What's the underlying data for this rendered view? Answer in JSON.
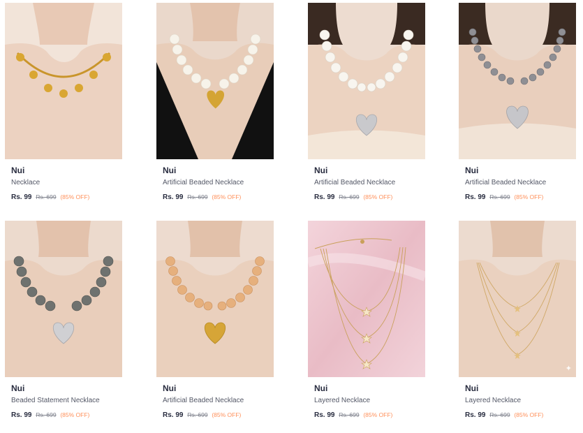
{
  "products": [
    {
      "brand": "Nui",
      "title": "Necklace",
      "price": "Rs. 99",
      "mrp": "Rs. 699",
      "discount": "(85% OFF)",
      "image": "gold-clover-station-necklace"
    },
    {
      "brand": "Nui",
      "title": "Artificial Beaded Necklace",
      "price": "Rs. 99",
      "mrp": "Rs. 699",
      "discount": "(85% OFF)",
      "image": "white-pearl-gold-heart-necklace"
    },
    {
      "brand": "Nui",
      "title": "Artificial Beaded Necklace",
      "price": "Rs. 99",
      "mrp": "Rs. 699",
      "discount": "(85% OFF)",
      "image": "white-pearl-silver-heart-necklace"
    },
    {
      "brand": "Nui",
      "title": "Artificial Beaded Necklace",
      "price": "Rs. 99",
      "mrp": "Rs. 699",
      "discount": "(85% OFF)",
      "image": "silver-bead-silver-heart-necklace"
    },
    {
      "brand": "Nui",
      "title": "Beaded Statement Necklace",
      "price": "Rs. 99",
      "mrp": "Rs. 699",
      "discount": "(85% OFF)",
      "image": "grey-pearl-silver-heart-necklace"
    },
    {
      "brand": "Nui",
      "title": "Artificial Beaded Necklace",
      "price": "Rs. 99",
      "mrp": "Rs. 699",
      "discount": "(85% OFF)",
      "image": "peach-pearl-gold-heart-necklace"
    },
    {
      "brand": "Nui",
      "title": "Layered Necklace",
      "price": "Rs. 99",
      "mrp": "Rs. 699",
      "discount": "(85% OFF)",
      "image": "layered-star-necklace-flatlay"
    },
    {
      "brand": "Nui",
      "title": "Layered Necklace",
      "price": "Rs. 99",
      "mrp": "Rs. 699",
      "discount": "(85% OFF)",
      "image": "layered-star-necklace-worn"
    }
  ],
  "colors": {
    "brand_text": "#282c3f",
    "title_text": "#535766",
    "mrp_text": "#7e818c",
    "discount_text": "#ff905a"
  }
}
